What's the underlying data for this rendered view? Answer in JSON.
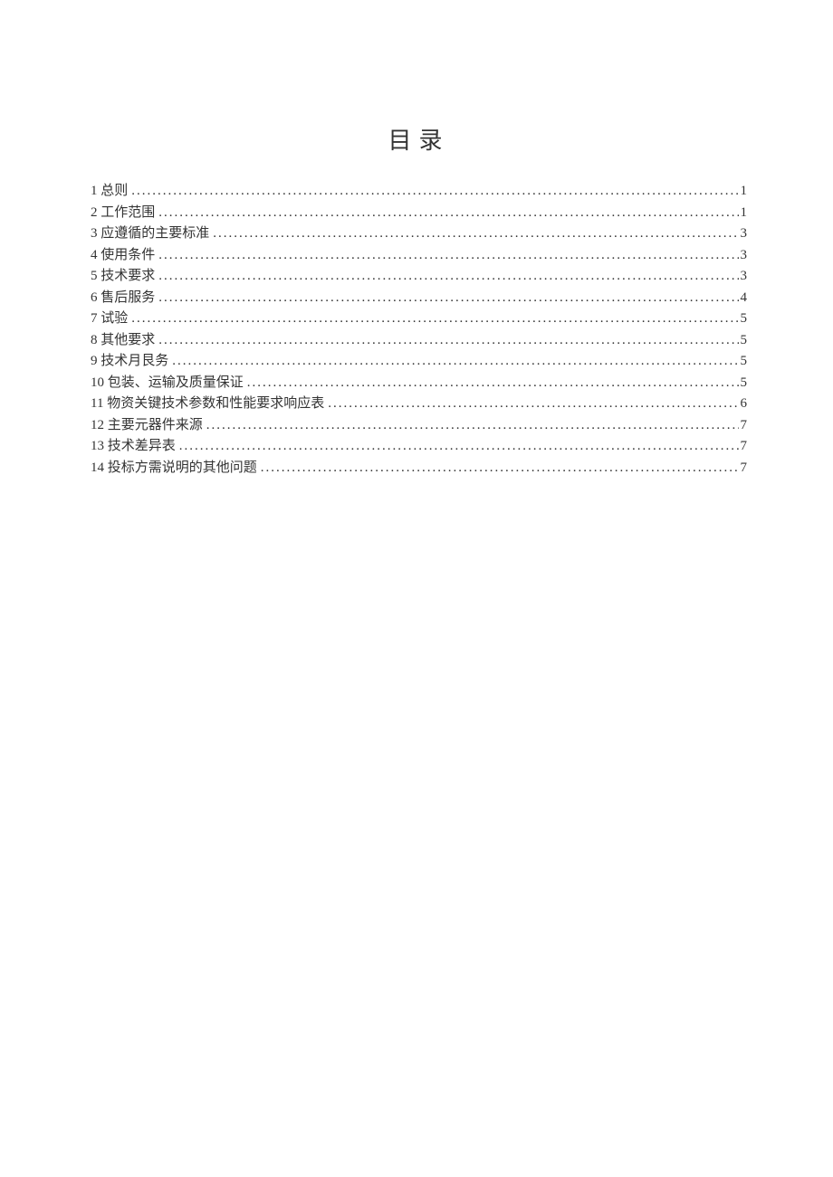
{
  "title": "目录",
  "entries": [
    {
      "label": "1 总则",
      "page": "1"
    },
    {
      "label": "2 工作范围",
      "page": "1"
    },
    {
      "label": "3 应遵循的主要标准",
      "page": "3"
    },
    {
      "label": "4 使用条件",
      "page": "3"
    },
    {
      "label": "5 技术要求",
      "page": "3"
    },
    {
      "label": "6 售后服务",
      "page": "4"
    },
    {
      "label": "7 试验",
      "page": "5"
    },
    {
      "label": "8 其他要求",
      "page": "5"
    },
    {
      "label": "9 技术月艮务",
      "page": "5"
    },
    {
      "label": "10 包装、运输及质量保证",
      "page": "5"
    },
    {
      "label": "11 物资关键技术参数和性能要求响应表",
      "page": "6"
    },
    {
      "label": "12 主要元器件来源",
      "page": "7"
    },
    {
      "label": "13 技术差异表",
      "page": "7"
    },
    {
      "label": "14 投标方需说明的其他问题",
      "page": "7"
    }
  ]
}
